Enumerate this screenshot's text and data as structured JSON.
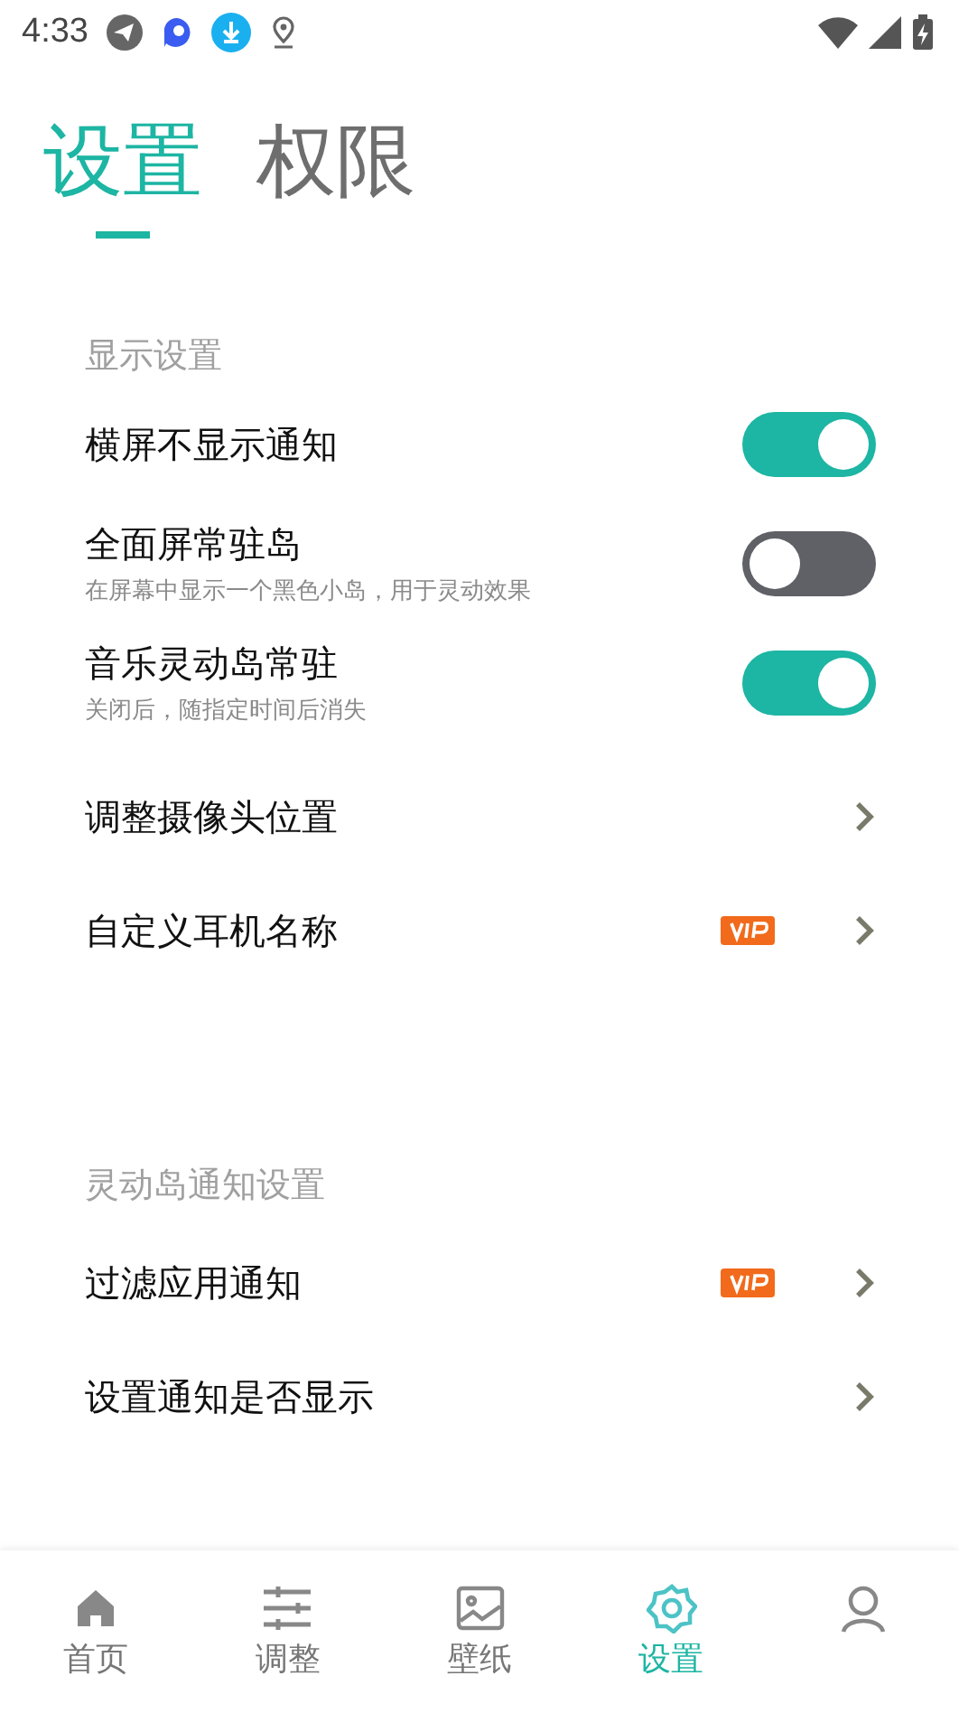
{
  "status_bar": {
    "time": "4:33"
  },
  "tabs": [
    {
      "label": "设置",
      "selected": true
    },
    {
      "label": "权限",
      "selected": false
    }
  ],
  "sections": [
    {
      "title": "显示设置",
      "items": [
        {
          "kind": "toggle",
          "label": "横屏不显示通知",
          "on": true
        },
        {
          "kind": "toggle",
          "label": "全面屏常驻岛",
          "subtitle": "在屏幕中显示一个黑色小岛，用于灵动效果",
          "on": false
        },
        {
          "kind": "toggle",
          "label": "音乐灵动岛常驻",
          "subtitle": "关闭后，随指定时间后消失",
          "on": true
        },
        {
          "kind": "link",
          "label": "调整摄像头位置",
          "vip": false
        },
        {
          "kind": "link",
          "label": "自定义耳机名称",
          "vip": true
        }
      ]
    },
    {
      "title": "灵动岛通知设置",
      "items": [
        {
          "kind": "link",
          "label": "过滤应用通知",
          "vip": true
        },
        {
          "kind": "link",
          "label": "设置通知是否显示",
          "vip": false
        }
      ]
    }
  ],
  "bottom_nav": [
    {
      "kind": "home",
      "label": "首页",
      "selected": false
    },
    {
      "kind": "sliders",
      "label": "调整",
      "selected": false
    },
    {
      "kind": "image",
      "label": "壁纸",
      "selected": false
    },
    {
      "kind": "gear",
      "label": "设置",
      "selected": true
    },
    {
      "kind": "person",
      "selected": false
    }
  ]
}
